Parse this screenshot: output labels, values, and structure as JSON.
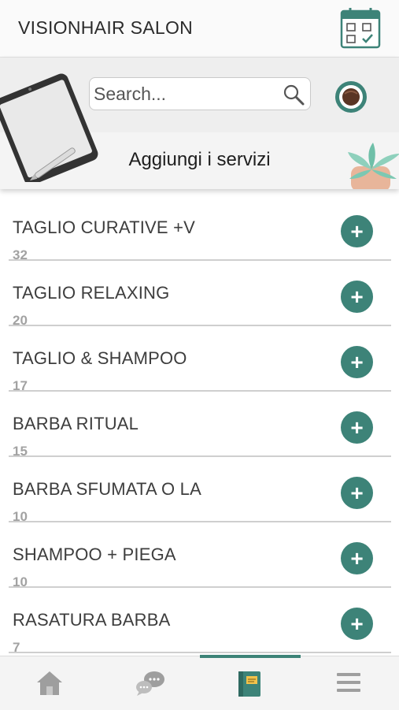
{
  "header": {
    "title": "VISIONHAIR SALON"
  },
  "search": {
    "placeholder": "Search..."
  },
  "banner": {
    "title": "Aggiungi i servizi"
  },
  "services": [
    {
      "name": "TAGLIO CURATIVE +V",
      "count": "32"
    },
    {
      "name": "TAGLIO RELAXING",
      "count": "20"
    },
    {
      "name": "TAGLIO & SHAMPOO",
      "count": "17"
    },
    {
      "name": "BARBA RITUAL",
      "count": "15"
    },
    {
      "name": "BARBA SFUMATA O LA",
      "count": "10"
    },
    {
      "name": "SHAMPOO + PIEGA",
      "count": "10"
    },
    {
      "name": "RASATURA BARBA",
      "count": "7"
    }
  ],
  "bottom_nav": {
    "items": [
      {
        "icon": "home-icon"
      },
      {
        "icon": "chat-icon"
      },
      {
        "icon": "notebook-icon"
      },
      {
        "icon": "menu-icon"
      }
    ],
    "active_index": 2
  },
  "colors": {
    "accent": "#3d8378",
    "header_bg": "#fafafa",
    "banner_bg": "#eeeeee"
  }
}
